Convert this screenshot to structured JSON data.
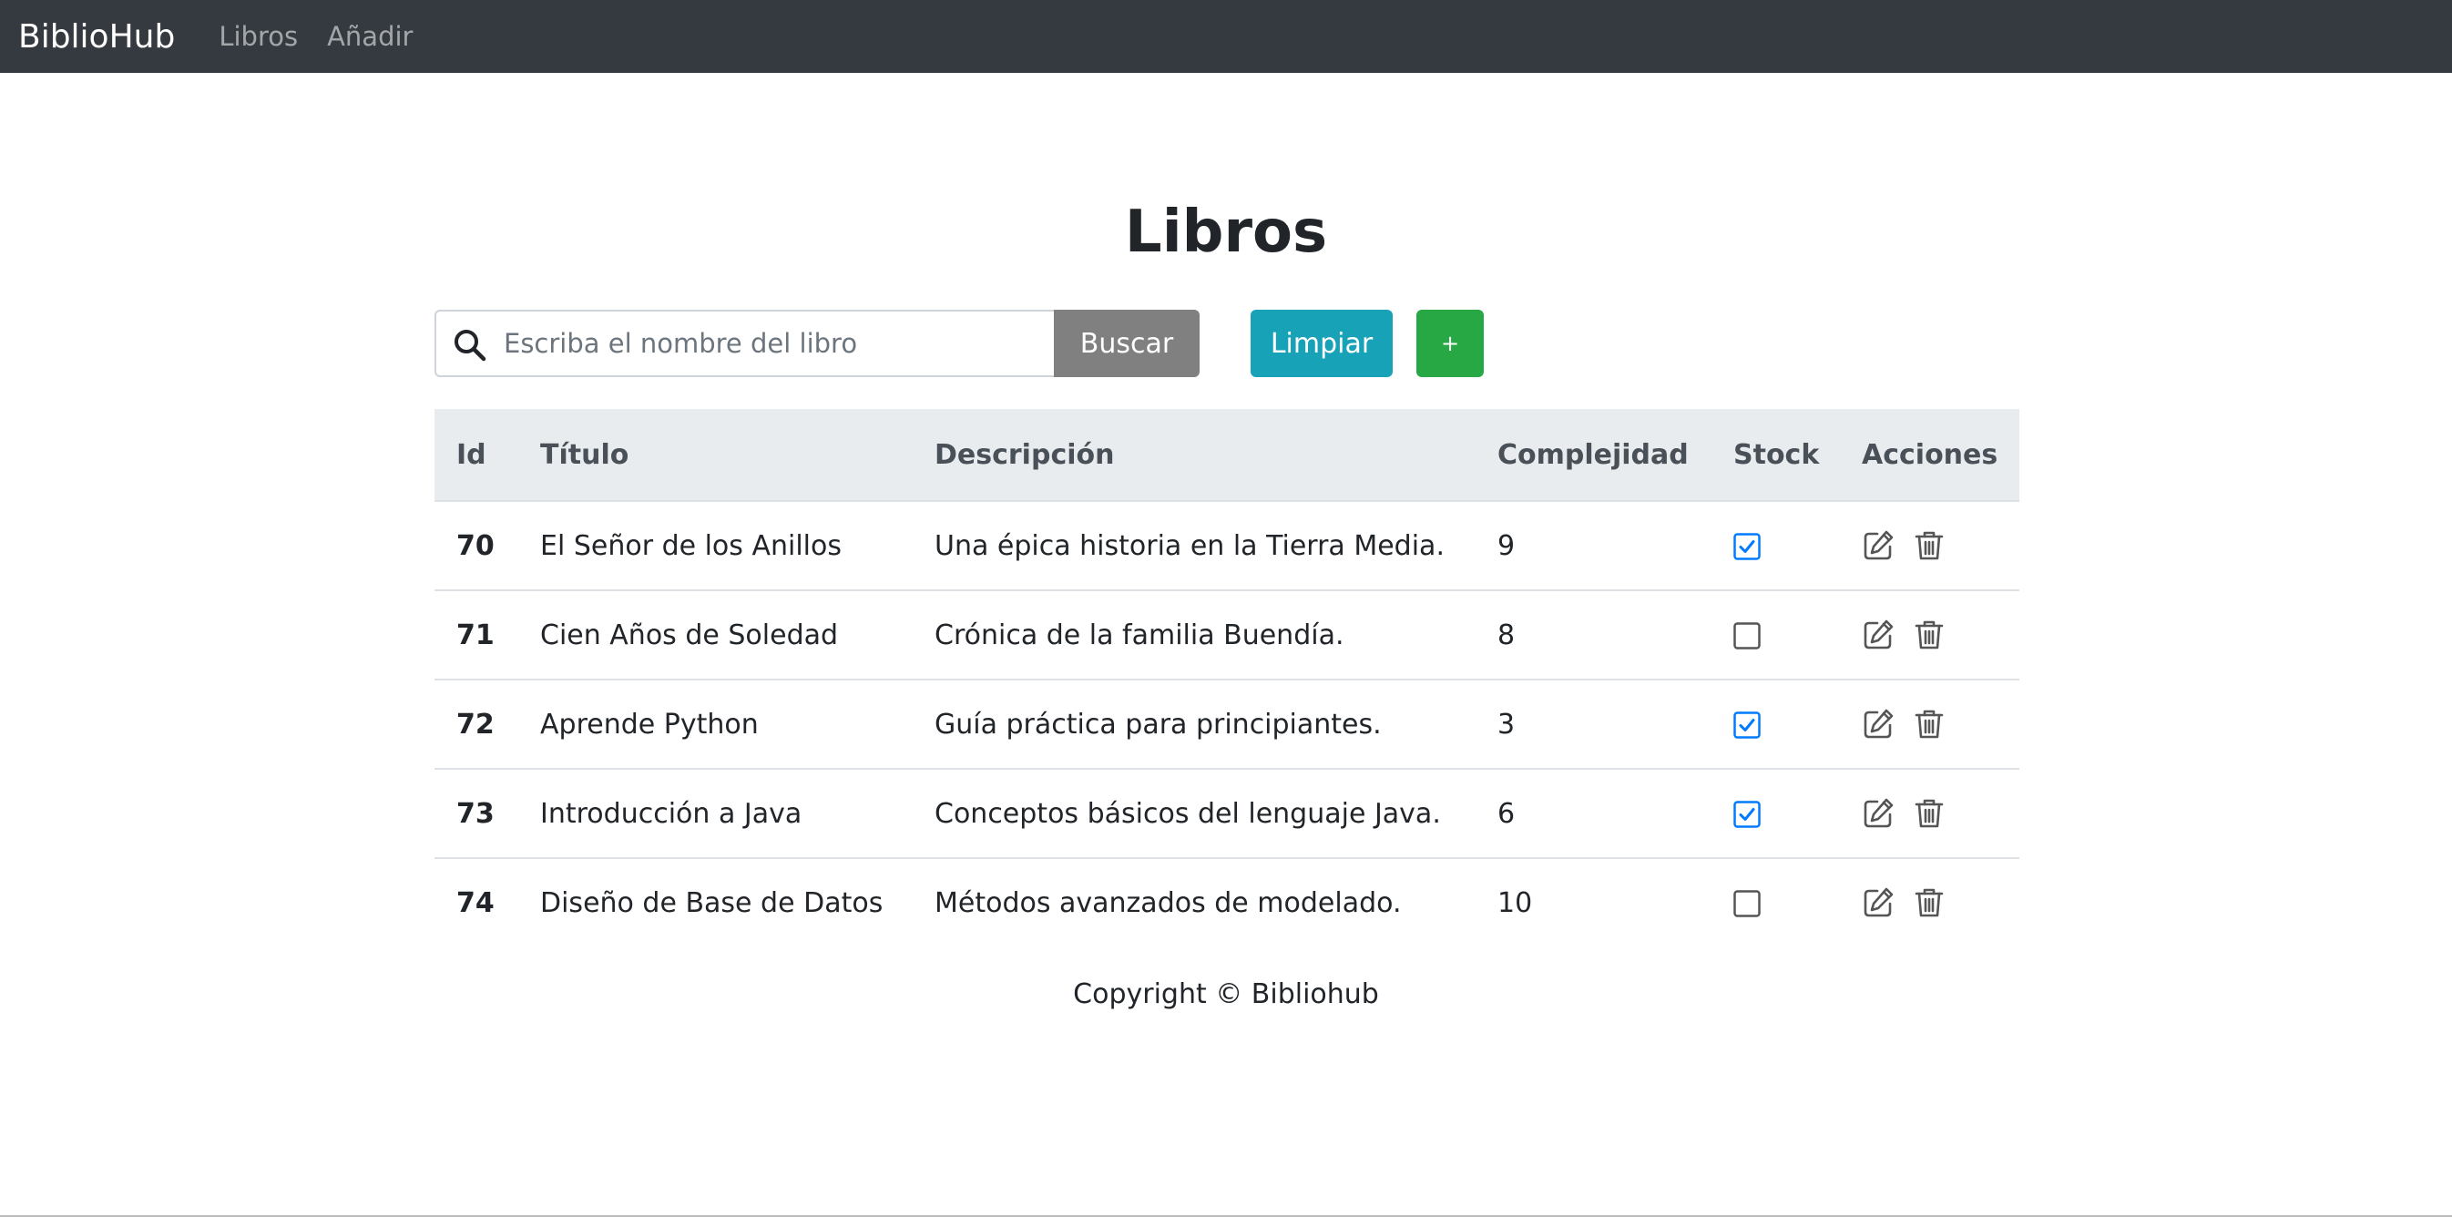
{
  "navbar": {
    "brand": "BiblioHub",
    "links": [
      "Libros",
      "Añadir"
    ]
  },
  "page": {
    "title": "Libros"
  },
  "search": {
    "placeholder": "Escriba el nombre del libro",
    "value": "",
    "icon": "search-icon"
  },
  "buttons": {
    "search": "Buscar",
    "clear": "Limpiar",
    "add": "+"
  },
  "table": {
    "headers": [
      "Id",
      "Título",
      "Descripción",
      "Complejidad",
      "Stock",
      "Acciones"
    ],
    "rows": [
      {
        "id": "70",
        "titulo": "El Señor de los Anillos",
        "descripcion": "Una épica historia en la Tierra Media.",
        "complejidad": "9",
        "stock": true
      },
      {
        "id": "71",
        "titulo": "Cien Años de Soledad",
        "descripcion": "Crónica de la familia Buendía.",
        "complejidad": "8",
        "stock": false
      },
      {
        "id": "72",
        "titulo": "Aprende Python",
        "descripcion": "Guía práctica para principiantes.",
        "complejidad": "3",
        "stock": true
      },
      {
        "id": "73",
        "titulo": "Introducción a Java",
        "descripcion": "Conceptos básicos del lenguaje Java.",
        "complejidad": "6",
        "stock": true
      },
      {
        "id": "74",
        "titulo": "Diseño de Base de Datos",
        "descripcion": "Métodos avanzados de modelado.",
        "complejidad": "10",
        "stock": false
      }
    ],
    "action_icons": [
      "edit-icon",
      "delete-icon"
    ]
  },
  "footer": {
    "text": "Copyright © Bibliohub"
  },
  "colors": {
    "navbar": "#343a40",
    "clear_button": "#17a2b8",
    "add_button": "#28a745",
    "search_button": "#808080",
    "checkbox_accent": "#007bff",
    "table_header": "#e9ecef"
  }
}
